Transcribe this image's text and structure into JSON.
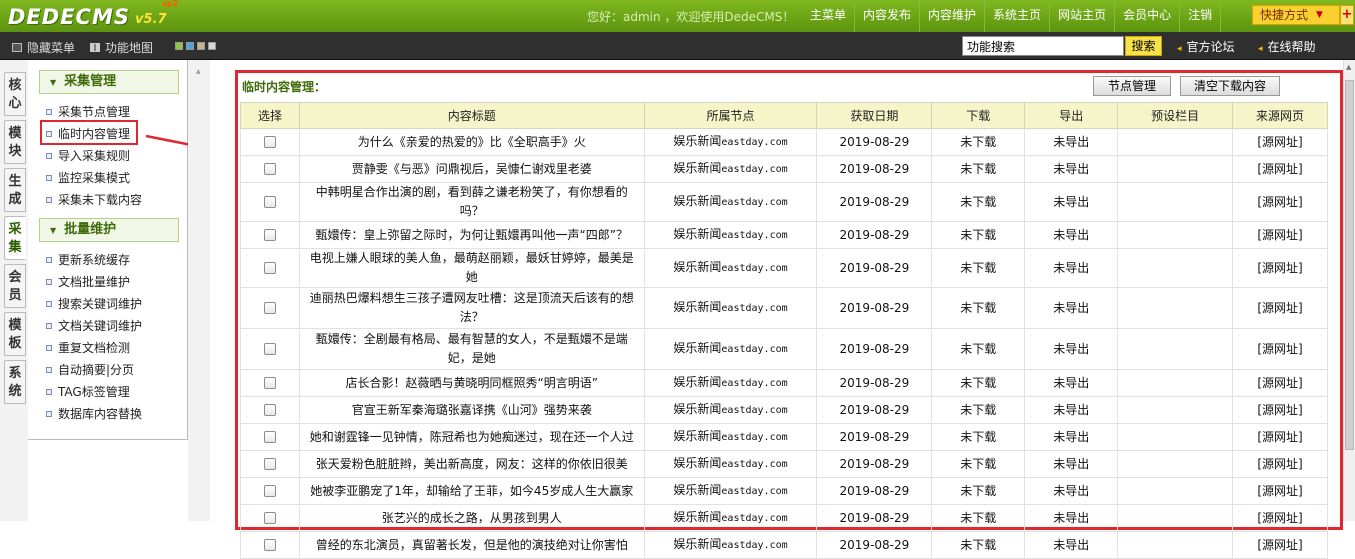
{
  "app": {
    "logo": "DEDECMS",
    "version": "v5.7",
    "version_sup": "sp2",
    "greeting": "您好：admin ，欢迎使用DedeCMS！"
  },
  "topnav": [
    "主菜单",
    "内容发布",
    "内容维护",
    "系统主页",
    "网站主页",
    "会员中心",
    "注销"
  ],
  "quick_menu": {
    "label": "快捷方式",
    "plus": "+"
  },
  "secbar": {
    "hide_menu": "隐藏菜单",
    "feature_map": "功能地图",
    "search_value": "功能搜索",
    "search_button": "搜索",
    "forum": "官方论坛",
    "help": "在线帮助",
    "swatches": [
      "#8ec63f",
      "#4fa3d8",
      "#c8b48a",
      "#d8d8d8"
    ]
  },
  "left_tabs": [
    "核心",
    "模块",
    "生成",
    "采集",
    "会员",
    "模板",
    "系统"
  ],
  "left_tabs_active": "采集",
  "left_menu": {
    "group1": {
      "title": "采集管理",
      "items": [
        "采集节点管理",
        "临时内容管理",
        "导入采集规则",
        "监控采集模式",
        "采集未下载内容"
      ]
    },
    "group2": {
      "title": "批量维护",
      "items": [
        "更新系统缓存",
        "文档批量维护",
        "搜索关键词维护",
        "文档关键词维护",
        "重复文档检测",
        "自动摘要|分页",
        "TAG标签管理",
        "数据库内容替换"
      ]
    }
  },
  "content": {
    "title": "临时内容管理：",
    "btn_node": "节点管理",
    "btn_clear": "清空下载内容",
    "columns": [
      "选择",
      "内容标题",
      "所属节点",
      "获取日期",
      "下载",
      "导出",
      "预设栏目",
      "来源网页"
    ],
    "rows": [
      {
        "title": "为什么《亲爱的热爱的》比《全职高手》火",
        "node_cn": "娱乐新闻",
        "node_en": "eastday.com",
        "date": "2019-08-29",
        "dl": "未下载",
        "ex": "未导出",
        "preset": "",
        "src": "[源网址]"
      },
      {
        "title": "贾静雯《与恶》问鼎视后，吴慷仁谢戏里老婆",
        "node_cn": "娱乐新闻",
        "node_en": "eastday.com",
        "date": "2019-08-29",
        "dl": "未下载",
        "ex": "未导出",
        "preset": "",
        "src": "[源网址]"
      },
      {
        "title": "中韩明星合作出演的剧，看到薛之谦老粉笑了，有你想看的吗？",
        "node_cn": "娱乐新闻",
        "node_en": "eastday.com",
        "date": "2019-08-29",
        "dl": "未下载",
        "ex": "未导出",
        "preset": "",
        "src": "[源网址]"
      },
      {
        "title": "甄嬛传：皇上弥留之际时，为何让甄嬛再叫他一声“四郎”？",
        "node_cn": "娱乐新闻",
        "node_en": "eastday.com",
        "date": "2019-08-29",
        "dl": "未下载",
        "ex": "未导出",
        "preset": "",
        "src": "[源网址]"
      },
      {
        "title": "电视上嫌人眼球的美人鱼，最萌赵丽颖，最妖甘婷婷，最美是她",
        "node_cn": "娱乐新闻",
        "node_en": "eastday.com",
        "date": "2019-08-29",
        "dl": "未下载",
        "ex": "未导出",
        "preset": "",
        "src": "[源网址]"
      },
      {
        "title": "迪丽热巴爆料想生三孩子遭网友吐槽：这是顶流天后该有的想法？",
        "node_cn": "娱乐新闻",
        "node_en": "eastday.com",
        "date": "2019-08-29",
        "dl": "未下载",
        "ex": "未导出",
        "preset": "",
        "src": "[源网址]"
      },
      {
        "title": "甄嬛传：全剧最有格局、最有智慧的女人，不是甄嬛不是端妃，是她",
        "node_cn": "娱乐新闻",
        "node_en": "eastday.com",
        "date": "2019-08-29",
        "dl": "未下载",
        "ex": "未导出",
        "preset": "",
        "src": "[源网址]"
      },
      {
        "title": "店长合影！赵薇晒与黄晓明同框照秀“明言明语”",
        "node_cn": "娱乐新闻",
        "node_en": "eastday.com",
        "date": "2019-08-29",
        "dl": "未下载",
        "ex": "未导出",
        "preset": "",
        "src": "[源网址]"
      },
      {
        "title": "官宣王新军秦海璐张嘉译携《山河》强势来袭",
        "node_cn": "娱乐新闻",
        "node_en": "eastday.com",
        "date": "2019-08-29",
        "dl": "未下载",
        "ex": "未导出",
        "preset": "",
        "src": "[源网址]"
      },
      {
        "title": "她和谢霆锋一见钟情，陈冠希也为她痴迷过，现在还一个人过",
        "node_cn": "娱乐新闻",
        "node_en": "eastday.com",
        "date": "2019-08-29",
        "dl": "未下载",
        "ex": "未导出",
        "preset": "",
        "src": "[源网址]"
      },
      {
        "title": "张天爱粉色脏脏辫，美出新高度，网友：这样的你依旧很美",
        "node_cn": "娱乐新闻",
        "node_en": "eastday.com",
        "date": "2019-08-29",
        "dl": "未下载",
        "ex": "未导出",
        "preset": "",
        "src": "[源网址]"
      },
      {
        "title": "她被李亚鹏宠了1年，却输给了王菲，如今45岁成人生大赢家",
        "node_cn": "娱乐新闻",
        "node_en": "eastday.com",
        "date": "2019-08-29",
        "dl": "未下载",
        "ex": "未导出",
        "preset": "",
        "src": "[源网址]"
      },
      {
        "title": "张艺兴的成长之路，从男孩到男人",
        "node_cn": "娱乐新闻",
        "node_en": "eastday.com",
        "date": "2019-08-29",
        "dl": "未下载",
        "ex": "未导出",
        "preset": "",
        "src": "[源网址]"
      },
      {
        "title": "曾经的东北演员，真留著长发，但是他的演技绝对让你害怕",
        "node_cn": "娱乐新闻",
        "node_en": "eastday.com",
        "date": "2019-08-29",
        "dl": "未下载",
        "ex": "未导出",
        "preset": "",
        "src": "[源网址]"
      }
    ]
  },
  "colors": {
    "accent_green": "#6aa516",
    "highlight_red": "#e0262e",
    "header_yellow": "#f6f4c9"
  }
}
